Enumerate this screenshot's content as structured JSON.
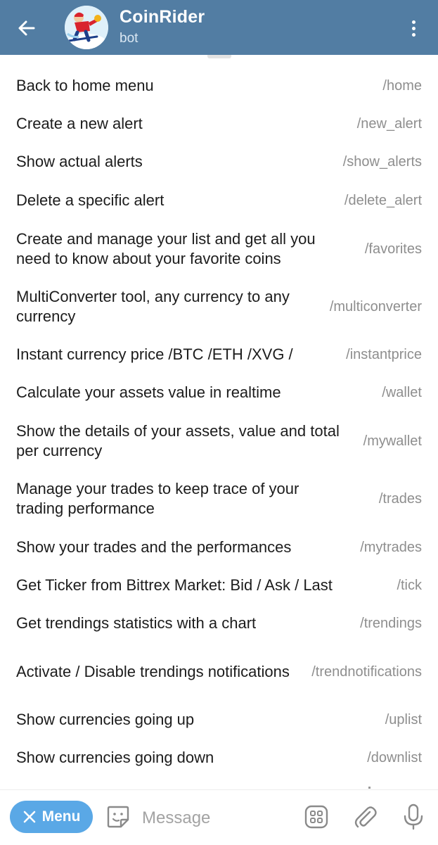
{
  "header": {
    "title": "CoinRider",
    "subtitle": "bot",
    "bar_color": "#527da3"
  },
  "commands": [
    {
      "description": "Back to home menu",
      "command": "/home"
    },
    {
      "description": "Create a new alert",
      "command": "/new_alert"
    },
    {
      "description": "Show actual alerts",
      "command": "/show_alerts"
    },
    {
      "description": "Delete a specific alert",
      "command": "/delete_alert"
    },
    {
      "description": "Create and manage your list and get all you need to know about your favorite coins",
      "command": "/favorites"
    },
    {
      "description": "MultiConverter tool, any currency to any currency",
      "command": "/multiconverter"
    },
    {
      "description": "Instant currency price /BTC /ETH /XVG /",
      "command": "/instantprice"
    },
    {
      "description": "Calculate your assets value in realtime",
      "command": "/wallet"
    },
    {
      "description": "Show the details of your assets, value and total per currency",
      "command": "/mywallet"
    },
    {
      "description": "Manage your trades to keep trace of your trading performance",
      "command": "/trades"
    },
    {
      "description": "Show your trades and the performances",
      "command": "/mytrades"
    },
    {
      "description": "Get Ticker from Bittrex Market: Bid / Ask / Last",
      "command": "/tick"
    },
    {
      "description": "Get trendings statistics with a chart",
      "command": "/trendings"
    },
    {
      "description": "Activate / Disable trendings notifications",
      "command": "/trendnotifications"
    },
    {
      "description": "Show currencies going up",
      "command": "/uplist"
    },
    {
      "description": "Show currencies going down",
      "command": "/downlist"
    }
  ],
  "input_bar": {
    "menu_label": "Menu",
    "menu_color": "#5aa8e6",
    "placeholder": "Message"
  },
  "icons": {
    "back": "arrow-left-icon",
    "more": "more-vertical-icon",
    "menu_close": "close-icon",
    "sticker": "sticker-icon",
    "apps": "apps-grid-icon",
    "attach": "paperclip-icon",
    "mic": "microphone-icon"
  }
}
